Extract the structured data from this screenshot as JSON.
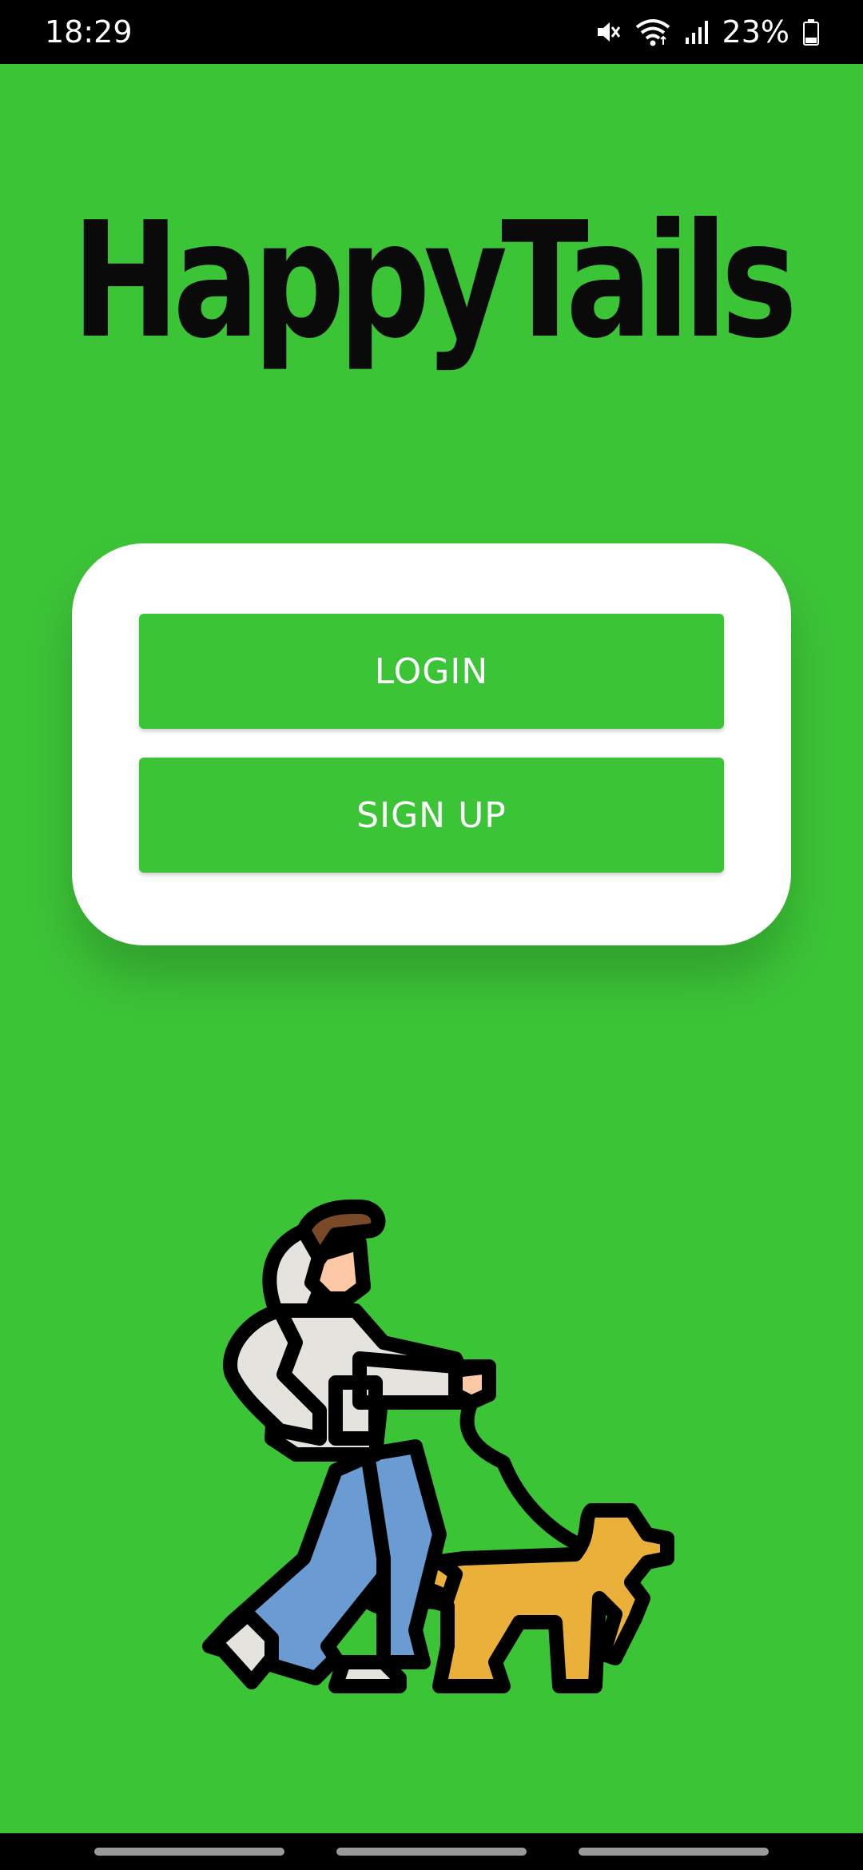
{
  "status_bar": {
    "time": "18:29",
    "battery_percent": "23%",
    "icons": [
      "mute-icon",
      "wifi-icon",
      "signal-icon",
      "battery-icon"
    ]
  },
  "app": {
    "logo_text": "HappyTails"
  },
  "auth_card": {
    "login_label": "LOGIN",
    "signup_label": "SIGN UP"
  },
  "illustration": {
    "icon": "person-walking-dog-icon"
  },
  "nav_bar": {
    "pills": [
      "nav-pill-left",
      "nav-pill-center",
      "nav-pill-right"
    ]
  },
  "colors": {
    "background": "#3cc437",
    "button": "#3cc437",
    "card": "#ffffff",
    "logo": "#0a0a0a",
    "dog": "#eab03a",
    "pants": "#6a9bd2",
    "jacket": "#e4e3de",
    "hair": "#7a4a28",
    "skin": "#fcc8a6"
  }
}
